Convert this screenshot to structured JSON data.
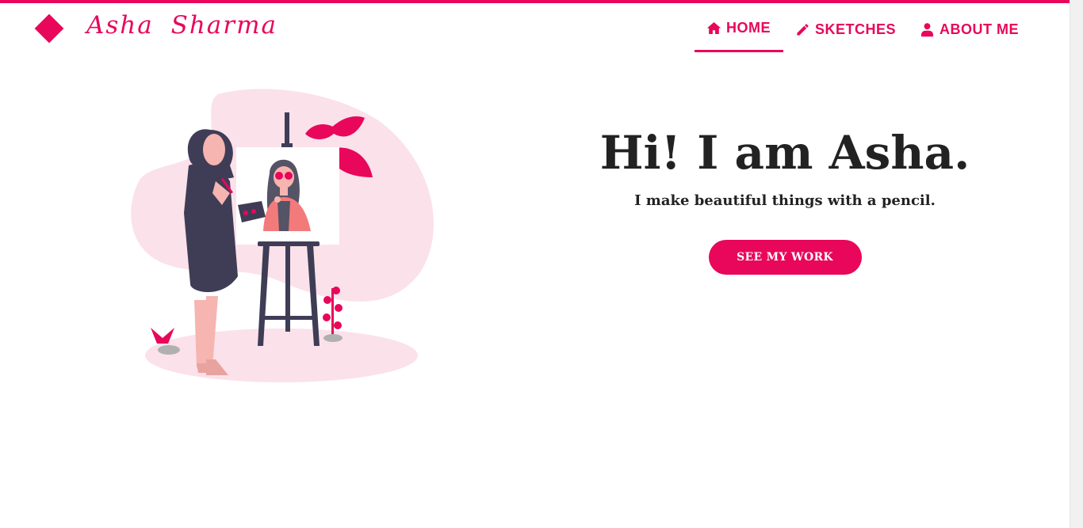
{
  "brand": {
    "name": "Asha  Sharma"
  },
  "nav": {
    "home_label": "HOME",
    "sketches_label": "SKETCHES",
    "about_label": "ABOUT ME",
    "active": "home"
  },
  "hero": {
    "title": "Hi! I am Asha.",
    "subtitle": "I make beautiful things with a pencil.",
    "cta_label": "SEE MY WORK"
  },
  "colors": {
    "accent": "#e8075a",
    "blob": "#fbe1ea",
    "dark": "#3f3d56",
    "text": "#222222"
  },
  "icons": {
    "home": "home-icon",
    "sketches": "pencil-icon",
    "about": "user-icon",
    "logo": "diamond-icon"
  }
}
